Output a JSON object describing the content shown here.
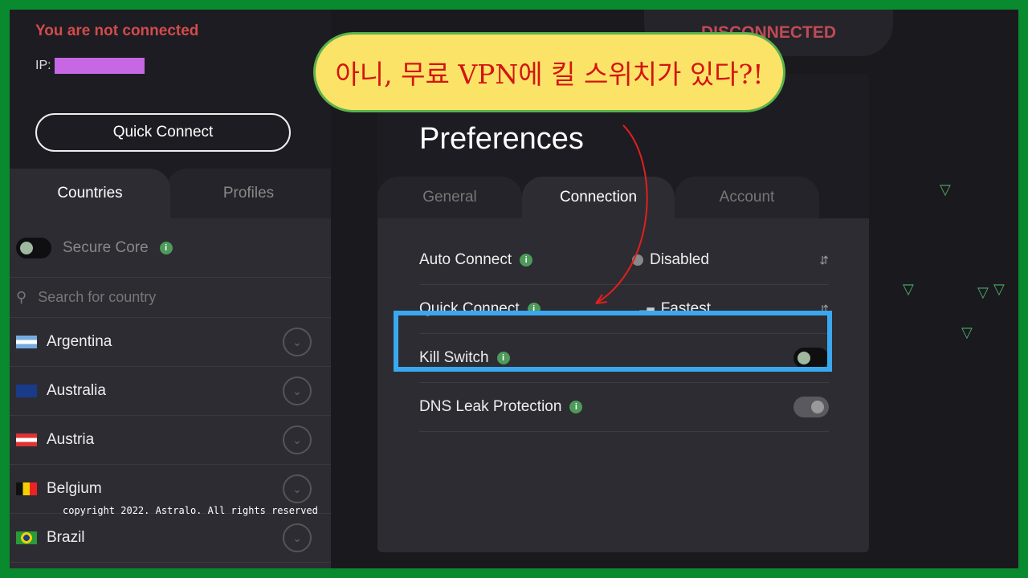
{
  "sidebar": {
    "status": "You are not connected",
    "ip_label": "IP:",
    "quick_connect": "Quick Connect",
    "tabs": [
      "Countries",
      "Profiles"
    ],
    "secure_core": "Secure Core",
    "search_placeholder": "Search for country",
    "countries": [
      "Argentina",
      "Australia",
      "Austria",
      "Belgium",
      "Brazil"
    ]
  },
  "map": {
    "status": "DISCONNECTED"
  },
  "preferences": {
    "title": "Preferences",
    "tabs": [
      "General",
      "Connection",
      "Account"
    ],
    "active_tab": "Connection",
    "settings": [
      {
        "label": "Auto Connect",
        "value": "Disabled"
      },
      {
        "label": "Quick Connect",
        "value": "Fastest"
      },
      {
        "label": "Kill Switch",
        "on": false
      },
      {
        "label": "DNS Leak Protection",
        "on": false
      }
    ]
  },
  "annotation": {
    "bubble": "아니, 무료 VPN에 킬 스위치가 있다?!",
    "copyright": "copyright 2022. Astralo. All rights reserved",
    "highlight_color": "#3aa8ee",
    "arrow_color": "#e0201c"
  }
}
